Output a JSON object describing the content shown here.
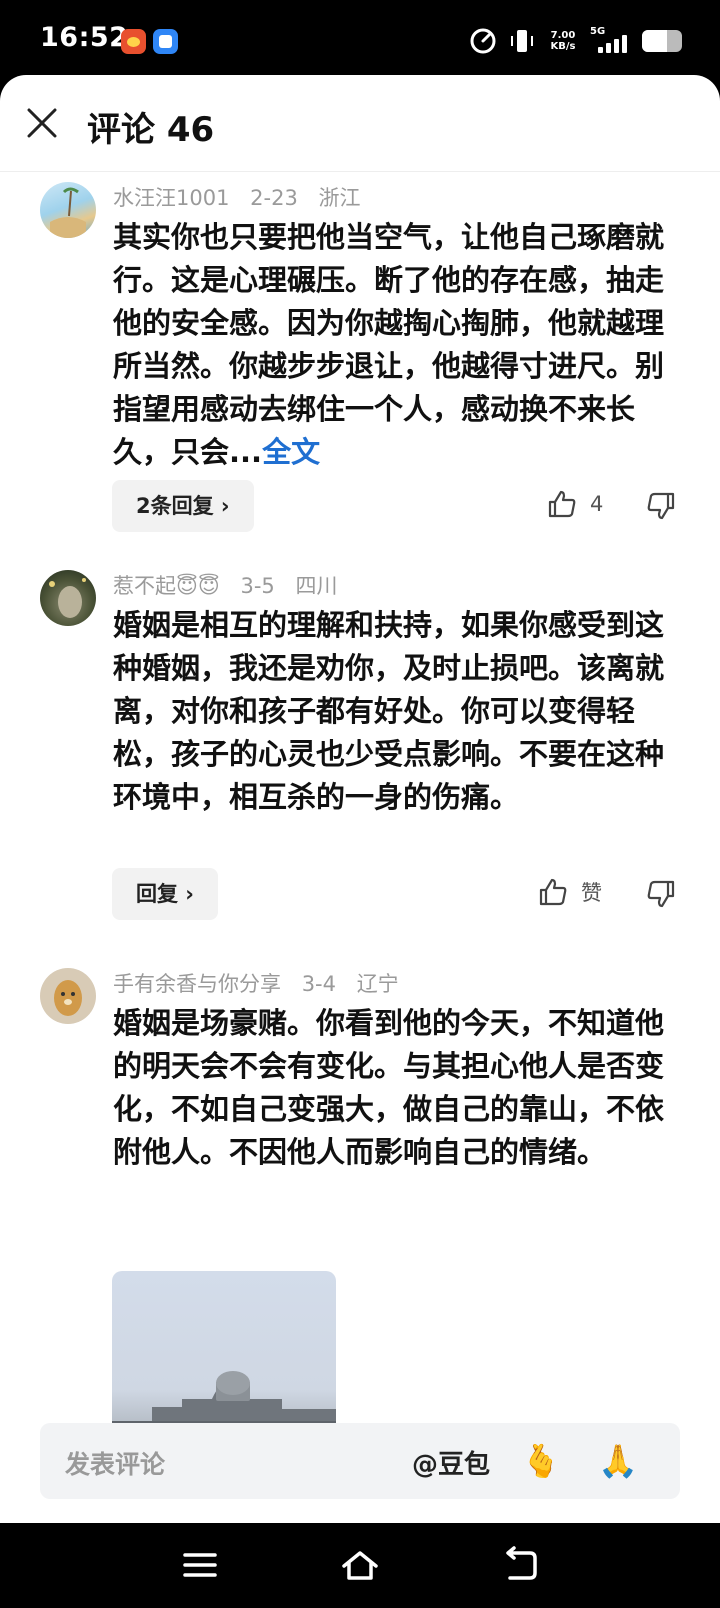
{
  "status_bar": {
    "time": "16:52",
    "net_speed_value": "7.00",
    "net_speed_unit": "KB/s",
    "network_type": "5G",
    "icons": [
      "app-notification-icon",
      "app-notification-icon",
      "speed-icon",
      "vibrate-icon",
      "signal-icon",
      "battery-icon"
    ]
  },
  "header": {
    "title": "评论 46"
  },
  "comments": [
    {
      "username": "水汪汪1001",
      "date": "2-23",
      "location": "浙江",
      "text": "其实你也只要把他当空气，让他自己琢磨就行。这是心理碾压。断了他的存在感，抽走他的安全感。因为你越掏心掏肺，他就越理所当然。你越步步退让，他越得寸进尺。别指望用感动去绑住一个人，感动换不来长久，只会...",
      "more_label": "全文",
      "reply_label": "2条回复 ›",
      "like_count": "4"
    },
    {
      "username": "惹不起😇😇",
      "date": "3-5",
      "location": "四川",
      "text": "婚姻是相互的理解和扶持，如果你感受到这种婚姻，我还是劝你，及时止损吧。该离就离，对你和孩子都有好处。你可以变得轻松，孩子的心灵也少受点影响。不要在这种环境中，相互杀的一身的伤痛。",
      "reply_label": "回复 ›",
      "like_count": "赞"
    },
    {
      "username": "手有余香与你分享",
      "date": "3-4",
      "location": "辽宁",
      "text": "婚姻是场豪赌。你看到他的今天，不知道他的明天会不会有变化。与其担心他人是否变化，不如自己变强大，做自己的靠山，不依附他人。不因他人而影响自己的情绪。",
      "has_image": true
    }
  ],
  "input_bar": {
    "placeholder": "发表评论",
    "mention_label": "@豆包",
    "emoji_1": "🫰",
    "emoji_2": "🙏"
  },
  "colors": {
    "link": "#1f6fd1",
    "meta_text": "#9a9a9a",
    "pill_bg": "#f2f2f2"
  }
}
